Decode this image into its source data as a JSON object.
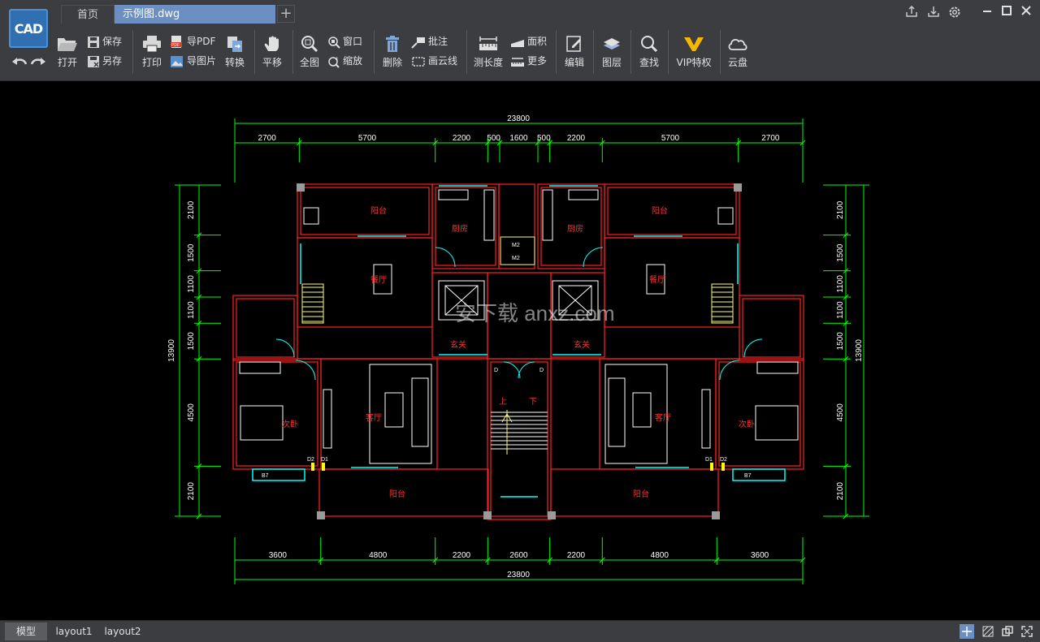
{
  "titlebar": {
    "logo_text": "CAD",
    "tabs": [
      "首页",
      "示例图.dwg"
    ],
    "add_tab": "+",
    "window_buttons": [
      "share-icon",
      "download-icon",
      "settings-icon",
      "minimize-icon",
      "maximize-icon",
      "close-icon"
    ]
  },
  "toolbar": {
    "open": "打开",
    "save": "保存",
    "save_as": "另存",
    "print": "打印",
    "export_pdf": "导PDF",
    "export_image": "导图片",
    "convert": "转换",
    "pan": "平移",
    "full_view": "全图",
    "window": "窗口",
    "zoom": "缩放",
    "delete": "删除",
    "annotate": "批注",
    "revcloud": "画云线",
    "measure_length": "测长度",
    "area": "面积",
    "more": "更多",
    "edit": "编辑",
    "layers": "图层",
    "find": "查找",
    "vip": "VIP特权",
    "cloud": "云盘"
  },
  "drawing": {
    "overall_dims": [
      "23800",
      "23800"
    ],
    "top_dims": [
      "2700",
      "5700",
      "2200",
      "500",
      "1600",
      "500",
      "2200",
      "5700",
      "2700"
    ],
    "bottom_dims": [
      "3600",
      "4800",
      "2200",
      "2600",
      "2200",
      "4800",
      "3600"
    ],
    "left_dims": [
      "2100",
      "1500",
      "1100",
      "1100",
      "1500",
      "4500",
      "2100"
    ],
    "right_dims": [
      "2100",
      "1500",
      "1100",
      "1100",
      "1500",
      "4500",
      "2100"
    ],
    "side_total": "13900",
    "rooms": {
      "balcony": "阳台",
      "kitchen": "厨房",
      "dining": "餐厅",
      "entry": "玄关",
      "living": "客厅",
      "bedroom": "次卧"
    },
    "stair_up": "上",
    "stair_down": "下",
    "tags": [
      "D2",
      "D1",
      "D",
      "D"
    ],
    "window_tags": [
      "M2",
      "M2"
    ],
    "cabinet_tags": [
      "B7",
      "B7"
    ],
    "watermark": "安下载 anxz.com"
  },
  "layout_tabs": [
    "模型",
    "layout1",
    "layout2"
  ],
  "colors": {
    "wall": "#ff2020",
    "dimension": "#00ff00",
    "window": "#00ffff",
    "room_label": "#ff3030",
    "furniture": "#ffffff",
    "stair": "#ffff66",
    "dim_text": "#ffffff"
  }
}
